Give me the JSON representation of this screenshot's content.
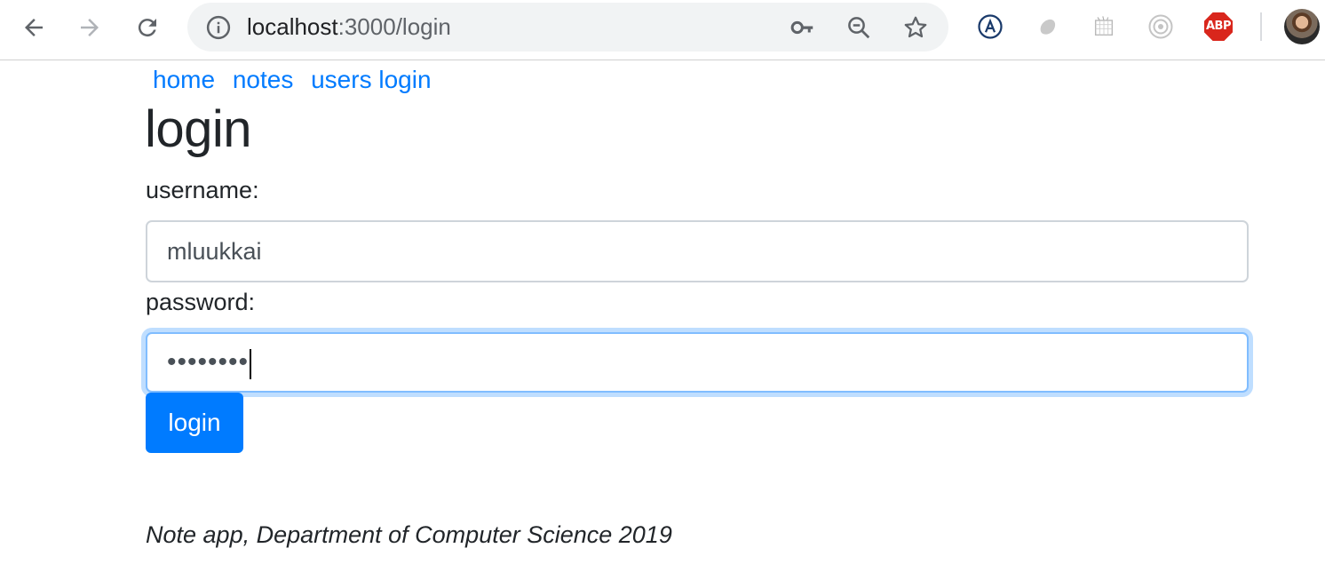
{
  "browser": {
    "url_host": "localhost",
    "url_rest": ":3000/login",
    "icons": {
      "back": "arrow-left-icon",
      "forward": "arrow-right-icon",
      "reload": "reload-icon",
      "site_info": "info-icon",
      "password_key": "key-icon",
      "zoom": "zoom-out-icon",
      "bookmark": "star-icon"
    },
    "extensions": [
      "a-circle-icon",
      "grey-blob-icon",
      "calendar-icon",
      "target-icon",
      "adblock-icon"
    ],
    "adblock_label": "ABP"
  },
  "nav": {
    "links": [
      "home",
      "notes",
      "users login"
    ]
  },
  "page": {
    "title": "login",
    "username_label": "username:",
    "username_value": "mluukkai",
    "password_label": "password:",
    "password_masked": "••••••••",
    "login_button": "login"
  },
  "footer": {
    "text": "Note app, Department of Computer Science 2019"
  },
  "colors": {
    "link": "#007bff",
    "button_bg": "#007bff",
    "focus_ring": "#80bdff",
    "text": "#212529"
  }
}
